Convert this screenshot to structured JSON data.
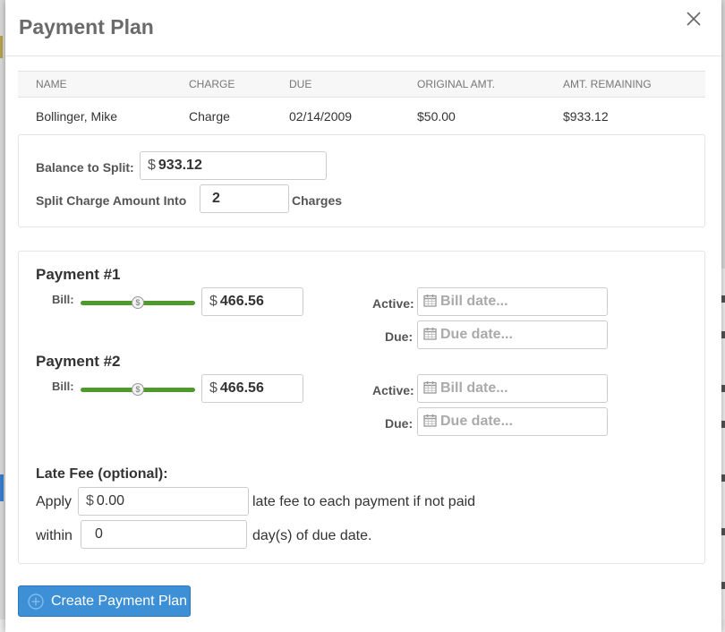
{
  "modal": {
    "title": "Payment Plan",
    "close_icon": "close-icon"
  },
  "table": {
    "headers": [
      "NAME",
      "CHARGE",
      "DUE",
      "ORIGINAL AMT.",
      "AMT. REMAINING"
    ],
    "row": {
      "name": "Bollinger, Mike",
      "charge": "Charge",
      "due": "02/14/2009",
      "original": "$50.00",
      "remaining": "$933.12"
    }
  },
  "split": {
    "balance_label": "Balance to Split:",
    "currency": "$",
    "balance_value": "933.12",
    "split_label": "Split Charge Amount Into",
    "split_count": "2",
    "charges_label": "Charges"
  },
  "payments": [
    {
      "title": "Payment #1",
      "bill_label": "Bill:",
      "slider_level": 0.5,
      "amount": "466.56",
      "active_label": "Active:",
      "active_placeholder": "Bill date...",
      "due_label": "Due:",
      "due_placeholder": "Due date..."
    },
    {
      "title": "Payment #2",
      "bill_label": "Bill:",
      "slider_level": 0.5,
      "amount": "466.56",
      "active_label": "Active:",
      "active_placeholder": "Bill date...",
      "due_label": "Due:",
      "due_placeholder": "Due date..."
    }
  ],
  "late_fee": {
    "title": "Late Fee (optional):",
    "apply_label": "Apply",
    "fee_value": "0.00",
    "fee_suffix": "late fee to each payment if not paid",
    "within_label": "within",
    "days_value": "0",
    "days_suffix": "day(s) of due date."
  },
  "actions": {
    "create_label": "Create Payment Plan",
    "create_icon": "plus-circle-icon"
  },
  "colors": {
    "primary": "#3d8fd6",
    "slider": "#4e9a2c"
  }
}
